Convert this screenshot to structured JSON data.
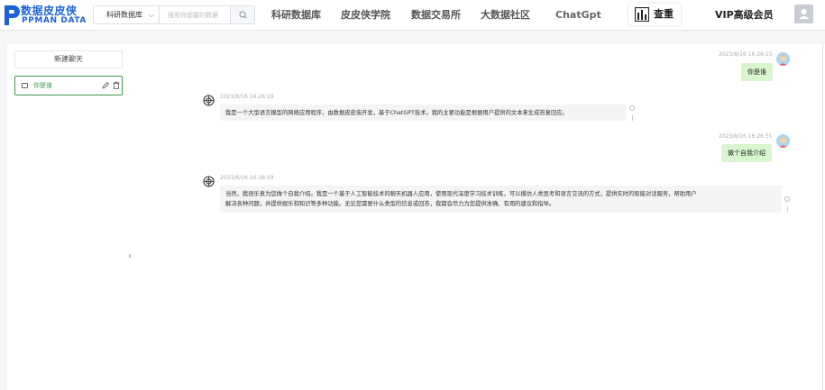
{
  "header": {
    "logo_cn": "数据皮皮侠",
    "logo_en": "PPMAN DATA",
    "search": {
      "category": "科研数据库",
      "placeholder": "搜索你想要的数据"
    },
    "nav": [
      "科研数据库",
      "皮皮侠学院",
      "数据交易所",
      "大数据社区",
      "ChatGpt"
    ],
    "pill_label": "查重",
    "vip_label": "VIP高级会员"
  },
  "sidebar": {
    "new_chat_label": "新建聊天",
    "conversation_label": "你是谁"
  },
  "messages": [
    {
      "role": "user",
      "time": "2023/8/16 16:26:15",
      "text": "你是谁"
    },
    {
      "role": "assistant",
      "time": "2023/8/16 16:26:19",
      "lines": [
        "我是一个大型语言模型的网络应用程序，由数据皮皮侠开发，基于ChatGPT技术。我的主要功能是根据用户提供的文本来生成答复回应。"
      ]
    },
    {
      "role": "user",
      "time": "2023/8/16 16:26:51",
      "text": "做个自我介绍"
    },
    {
      "role": "assistant",
      "time": "2023/8/16 16:26:59",
      "lines": [
        "当然，我很乐意为您做个自我介绍。我是一个基于人工智能技术的聊天机器人应用，使用现代深度学习技术训练，可以模仿人类思考和语言交流的方式，提供实时的智能对话服务，帮助用户",
        "解决各种问题，并提供娱乐和知识等多种功能。无论您需要什么类型的信息或回答，我都会尽力为您提供准确、有用的建议和指导。"
      ]
    }
  ],
  "colors": {
    "brand": "#1d63d8",
    "accent_green": "#3a9a4a",
    "user_bubble": "#d9f5cf",
    "bot_bubble": "#f4f4f5"
  }
}
